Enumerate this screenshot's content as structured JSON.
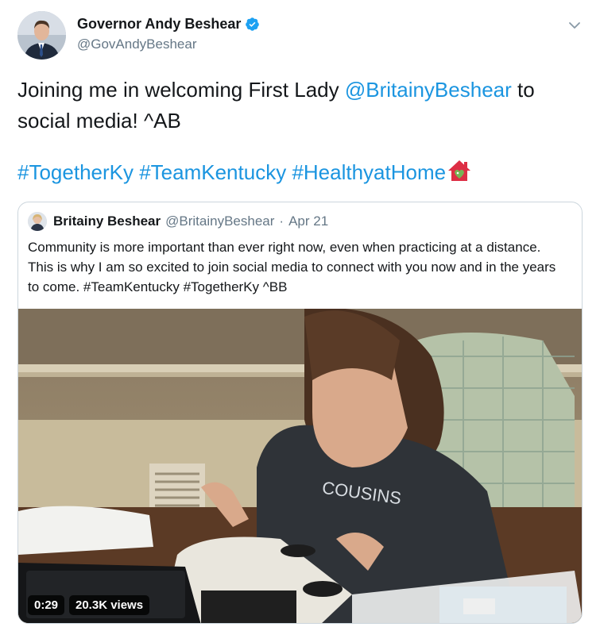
{
  "author": {
    "display_name": "Governor Andy Beshear",
    "handle": "@GovAndyBeshear",
    "verified": true
  },
  "tweet": {
    "line1_before": "Joining me in welcoming First Lady ",
    "line1_mention": "@BritainyBeshear",
    "line1_after": " to",
    "line2": "social media! ^AB",
    "hashtags": [
      "#TogetherKy",
      "#TeamKentucky",
      "#HealthyatHome"
    ],
    "emoji": "house-with-heart-icon"
  },
  "quoted": {
    "display_name": "Britainy Beshear",
    "handle": "@BritainyBeshear",
    "separator": "·",
    "date": "Apr 21",
    "text": "Community is more important than ever right now, even when practicing at a distance. This is why I am so excited to join social media to connect with you now and in the years to come. #TeamKentucky #TogetherKy ^BB",
    "video": {
      "duration": "0:29",
      "views": "20.3K views"
    }
  },
  "colors": {
    "link": "#1b95e0",
    "secondary_text": "#657786",
    "border": "#ccd6dd",
    "verified": "#1da1f2"
  }
}
